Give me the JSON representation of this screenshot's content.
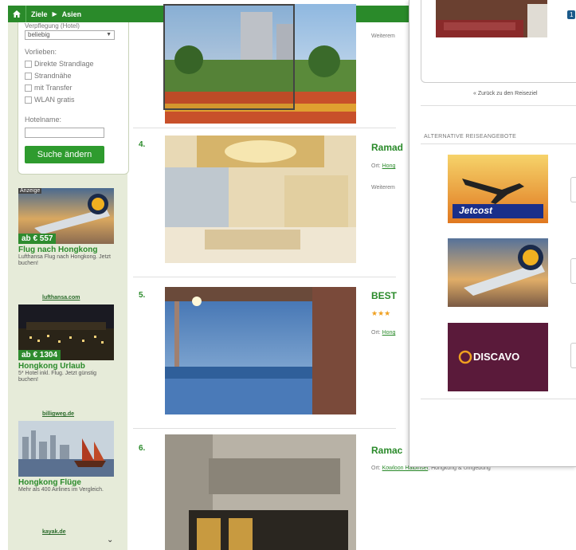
{
  "nav": {
    "home_icon": "home-icon",
    "crumbs": [
      "Ziele",
      "Asien"
    ],
    "separator": "▶",
    "color": "#2a8a2a"
  },
  "search": {
    "select_label": "Verpflegung (Hotel)",
    "select_value": "beliebig",
    "vorlieben_label": "Vorlieben:",
    "options": [
      "Direkte Strandlage",
      "Strandnähe",
      "mit Transfer",
      "WLAN gratis"
    ],
    "hotelname_label": "Hotelname:",
    "submit_label": "Suche ändern"
  },
  "ads": [
    {
      "badge": "Anzeige",
      "price": "ab € 557",
      "title": "Flug nach Hongkong",
      "description": "Lufthansa Flug nach Hongkong. Jetzt buchen!",
      "link": "lufthansa.com"
    },
    {
      "price": "ab € 1304",
      "title": "Hongkong Urlaub",
      "description": "5* Hotel inkl. Flug. Jetzt günstig buchen!",
      "link": "billigweg.de"
    },
    {
      "title": "Hongkong Flüge",
      "description": "Mehr als 400 Airlines im Vergleich.",
      "link": "kayak.de"
    }
  ],
  "results": [
    {
      "number": "",
      "title": "",
      "more": "Weiterem"
    },
    {
      "number": "4.",
      "title": "Ramad",
      "location_prefix": "Ort:",
      "location": "Hong",
      "more": "Weiterem"
    },
    {
      "number": "5.",
      "title": "BEST",
      "stars": "★★★",
      "location_prefix": "Ort:",
      "location": "Hong"
    },
    {
      "number": "6.",
      "title": "Ramac",
      "location_prefix": "Ort:",
      "location": "Kowloon Halbinsel",
      "region": ", Hongkong & Umgebung"
    }
  ],
  "panel": {
    "badge": "1",
    "back_link": "« Zurück zu den Reiseziel",
    "alt_heading": "ALTERNATIVE REISEANGEBOTE",
    "alt_offers": [
      "Jetcost",
      "",
      "DISCAVO"
    ]
  },
  "colors": {
    "brand_green": "#2a8a2a",
    "button_green": "#2e9b2e",
    "sidebar_bg": "#e6ebd9",
    "price_tag": "#2e8b2e",
    "stars": "#f0a020"
  }
}
